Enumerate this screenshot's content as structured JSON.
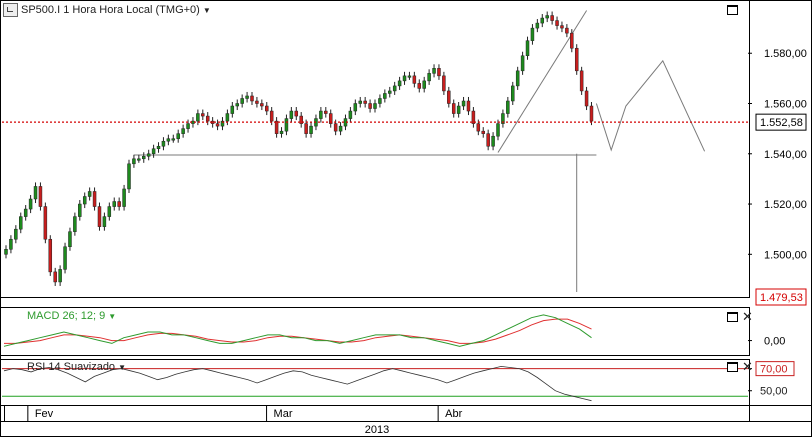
{
  "main_panel": {
    "title": "SP500.I 1 Hora Hora Local (TMG+0)"
  },
  "macd_panel": {
    "title": "MACD 26; 12; 9"
  },
  "rsi_panel": {
    "title": "RSI 14 Suavizado"
  },
  "colors": {
    "price_line": "#d40000",
    "low_label": "#d40000",
    "macd_line": "#2e9b2e",
    "macd_signal": "#e03030",
    "rsi_upper": "#c82020",
    "rsi_lower": "#20a020",
    "candle_up": "#1d8a1d",
    "candle_down": "#c81e1e",
    "pattern": "#7a7a7a"
  },
  "chart_data": [
    {
      "type": "candlestick",
      "title": "SP500.I 1 Hora Hora Local (TMG+0)",
      "ylim": [
        1485,
        1598
      ],
      "y_ticks": [
        "1.500,00",
        "1.520,00",
        "1.540,00",
        "1.560,00",
        "1.580,00"
      ],
      "y_tick_values": [
        1500,
        1520,
        1540,
        1560,
        1580
      ],
      "price_label": {
        "text": "1.552,58",
        "value": 1552.58
      },
      "low_label": {
        "text": "1.479,53",
        "value": 1479.53
      },
      "neckline": 1539.5,
      "series_close": [
        1502,
        1506,
        1510,
        1515,
        1518,
        1522,
        1527,
        1519,
        1506,
        1493,
        1489,
        1494,
        1503,
        1509,
        1515,
        1520,
        1523,
        1525,
        1519,
        1511,
        1515,
        1519,
        1521,
        1519,
        1526,
        1536,
        1538,
        1538,
        1539,
        1540,
        1542,
        1543,
        1545,
        1546,
        1546,
        1548,
        1550,
        1552,
        1553,
        1556,
        1555,
        1553,
        1552,
        1551,
        1553,
        1556,
        1559,
        1560,
        1562,
        1563,
        1561,
        1560,
        1559,
        1557,
        1553,
        1548,
        1549,
        1554,
        1557,
        1555,
        1552,
        1548,
        1551,
        1554,
        1557,
        1556,
        1552,
        1549,
        1551,
        1554,
        1557,
        1560,
        1561,
        1560,
        1558,
        1560,
        1562,
        1564,
        1565,
        1567,
        1569,
        1571,
        1571,
        1568,
        1566,
        1569,
        1572,
        1574,
        1571,
        1565,
        1560,
        1556,
        1559,
        1561,
        1557,
        1552,
        1549,
        1548,
        1543,
        1547,
        1552,
        1556,
        1561,
        1567,
        1573,
        1579,
        1585,
        1590,
        1592,
        1594,
        1595,
        1593,
        1591,
        1590,
        1588,
        1582,
        1573,
        1565,
        1559,
        1553
      ],
      "annotations": [
        {
          "kind": "line",
          "points": [
            [
              26,
              1539.5
            ],
            [
              120,
              1539.5
            ]
          ]
        },
        {
          "kind": "line",
          "points": [
            [
              100,
              1540.5
            ],
            [
              118,
              1597
            ]
          ]
        },
        {
          "kind": "line",
          "points": [
            [
              116,
              1540
            ],
            [
              116,
              1485
            ]
          ]
        },
        {
          "kind": "line",
          "points": [
            [
              120,
              1560
            ],
            [
              123,
              1541.5
            ],
            [
              126,
              1559
            ],
            [
              133.5,
              1577
            ],
            [
              142,
              1541
            ]
          ]
        }
      ]
    },
    {
      "type": "line",
      "title": "MACD 26; 12; 9",
      "ylim": [
        -4,
        10
      ],
      "y_ticks": [
        "0,00"
      ],
      "y_tick_values": [
        0
      ],
      "series": [
        {
          "values": [
            -2,
            -1,
            0,
            1,
            2,
            3,
            2,
            1,
            0,
            -1,
            1,
            2,
            3,
            3,
            2,
            2,
            1,
            0,
            -1,
            -1,
            0,
            1,
            2,
            2,
            1,
            1,
            0,
            0,
            -1,
            0,
            1,
            2,
            2,
            2,
            1,
            1,
            0,
            -1,
            -2,
            -1,
            0,
            2,
            4,
            6,
            8,
            9,
            8,
            6,
            4,
            1
          ]
        },
        {
          "values": [
            -1,
            -1,
            -0.5,
            0,
            1,
            2,
            2,
            1.5,
            1,
            0,
            0,
            1,
            2,
            2.5,
            2.5,
            2,
            1.5,
            0.5,
            0,
            -0.5,
            -0.5,
            0,
            1,
            1.5,
            1.5,
            1,
            0.5,
            0,
            -0.5,
            -0.5,
            0,
            1,
            1.5,
            2,
            1.5,
            1,
            0.5,
            0,
            -1,
            -1,
            -0.5,
            0.5,
            2,
            3.5,
            5.5,
            7,
            7.5,
            7.5,
            6,
            4
          ]
        }
      ]
    },
    {
      "type": "line",
      "title": "RSI 14 Suavizado",
      "ylim": [
        38,
        76
      ],
      "y_ticks": [
        "70,00",
        "50,00"
      ],
      "y_tick_values": [
        70,
        50
      ],
      "levels": [
        70,
        45
      ],
      "series": [
        {
          "values": [
            68,
            70,
            69,
            67,
            70,
            71,
            69,
            66,
            62,
            58,
            63,
            66,
            69,
            70,
            68,
            66,
            63,
            60,
            62,
            65,
            67,
            69,
            70,
            68,
            66,
            64,
            62,
            60,
            57,
            60,
            63,
            66,
            68,
            67,
            64,
            62,
            60,
            58,
            56,
            59,
            62,
            65,
            68,
            70,
            68,
            66,
            64,
            62,
            60,
            57,
            60,
            63,
            66,
            68,
            70,
            72,
            71,
            70,
            67,
            62,
            56,
            50,
            47,
            45,
            43,
            41
          ]
        }
      ]
    }
  ],
  "x_axis": {
    "labels": [
      {
        "text": "Fev",
        "frac": 0.04
      },
      {
        "text": "Mar",
        "frac": 0.36
      },
      {
        "text": "Abr",
        "frac": 0.59
      }
    ],
    "year": "2013"
  }
}
